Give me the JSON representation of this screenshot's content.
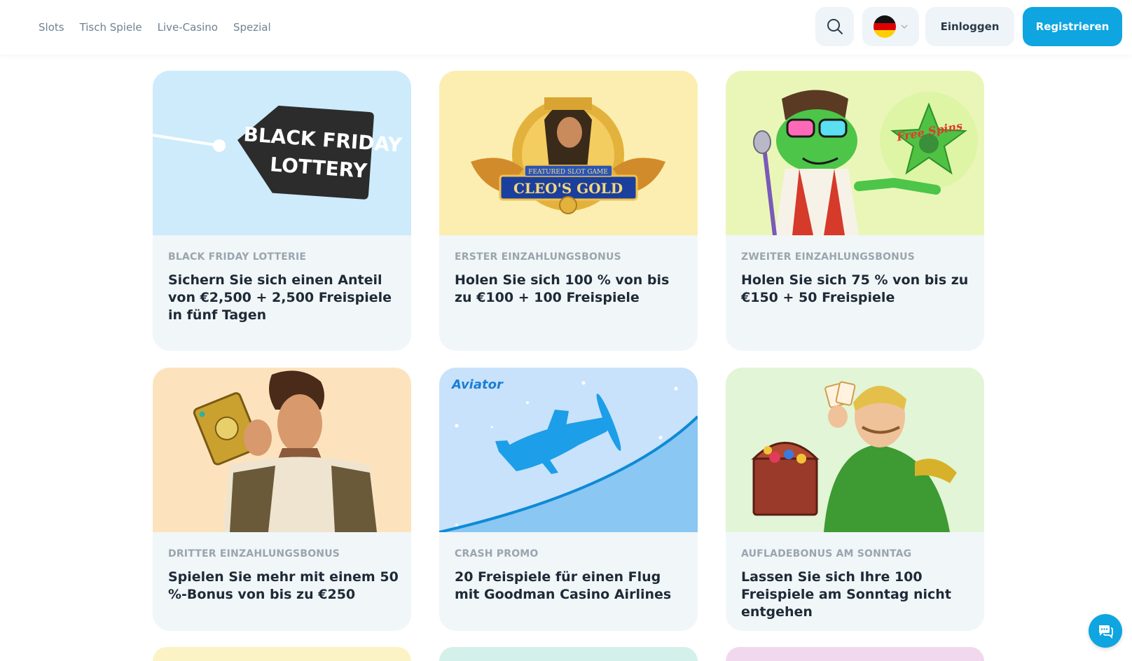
{
  "nav": {
    "items": [
      {
        "label": "Slots"
      },
      {
        "label": "Tisch Spiele"
      },
      {
        "label": "Live-Casino"
      },
      {
        "label": "Spezial"
      }
    ]
  },
  "header": {
    "search_icon": "search-icon",
    "language": {
      "flag": "germany-flag-icon",
      "chevron": "chevron-down-icon"
    },
    "login_label": "Einloggen",
    "register_label": "Registrieren"
  },
  "promos": [
    {
      "image_text": {
        "line1": "BLACK FRIDAY",
        "line2": "LOTTERY"
      },
      "category": "BLACK FRIDAY LOTTERIE",
      "title": "Sichern Sie sich einen Anteil von €2,500 + 2,500 Freispiele in fünf Tagen",
      "bg": "#cdebfb"
    },
    {
      "image_text": {
        "badge": "FEATURED SLOT GAME",
        "name": "CLEO'S GOLD"
      },
      "category": "ERSTER EINZAHLUNGSBONUS",
      "title": "Holen Sie sich 100 % von bis zu €100 + 100 Freispiele",
      "bg": "#fbeeb0"
    },
    {
      "image_text": {
        "badge": "Free Spins"
      },
      "category": "ZWEITER EINZAHLUNGSBONUS",
      "title": "Holen Sie sich 75 % von bis zu €150 + 50 Freispiele",
      "bg": "#eaf6b8"
    },
    {
      "category": "DRITTER EINZAHLUNGSBONUS",
      "title": "Spielen Sie mehr mit einem 50 %-Bonus von bis zu €250",
      "bg": "#fde3bd"
    },
    {
      "image_text": {
        "logo": "Aviator"
      },
      "category": "CRASH PROMO",
      "title": "20 Freispiele für einen Flug mit Goodman Casino Airlines",
      "bg": "#c8e2fb"
    },
    {
      "category": "AUFLADEBONUS AM SONNTAG",
      "title": "Lassen Sie sich Ihre 100 Freispiele am Sonntag nicht entgehen",
      "bg": "#e2f5d6"
    }
  ],
  "colors": {
    "accent": "#0ea5e0",
    "card_bg": "#f1f6f9",
    "category_text": "#9aa5ae",
    "title_text": "#1e2a36"
  },
  "chat": {
    "icon": "chat-icon"
  }
}
